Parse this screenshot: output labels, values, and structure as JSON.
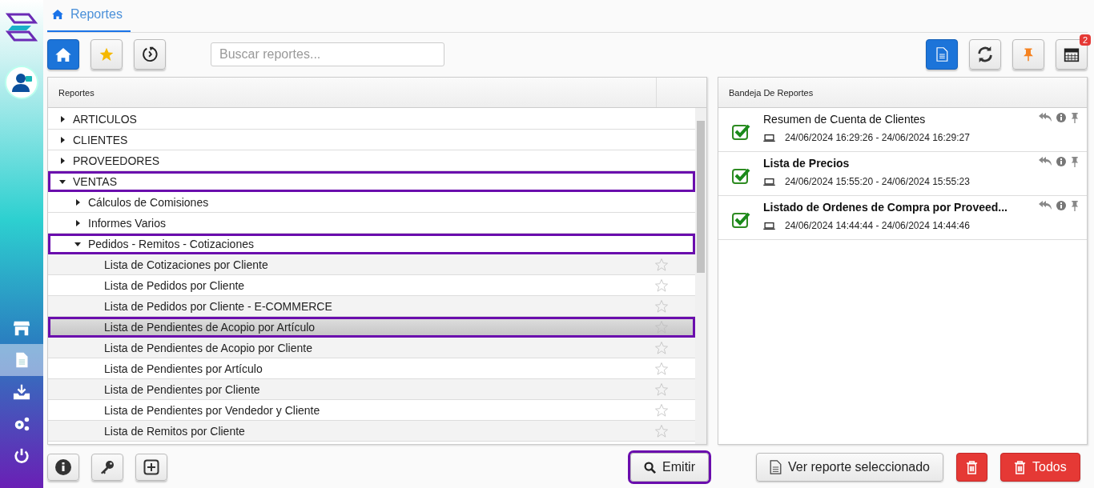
{
  "sidebar": {
    "items": [
      {
        "kind": "store",
        "selected": false
      },
      {
        "kind": "document",
        "selected": true
      },
      {
        "kind": "inbox",
        "selected": false
      },
      {
        "kind": "gears",
        "selected": false
      },
      {
        "kind": "power",
        "selected": false
      }
    ]
  },
  "tab": {
    "label": "Reportes",
    "selected": true
  },
  "search": {
    "placeholder": "Buscar reportes..."
  },
  "calendar_badge": "2",
  "reports_panel": {
    "title": "Reportes",
    "tree": [
      {
        "label": "ARTICULOS",
        "expanded": false,
        "highlighted": false
      },
      {
        "label": "CLIENTES",
        "expanded": false,
        "highlighted": false
      },
      {
        "label": "PROVEEDORES",
        "expanded": false,
        "highlighted": false
      },
      {
        "label": "VENTAS",
        "expanded": true,
        "highlighted": true,
        "children": [
          {
            "label": "Cálculos de Comisiones",
            "expanded": false,
            "highlighted": false
          },
          {
            "label": "Informes Varios",
            "expanded": false,
            "highlighted": false
          },
          {
            "label": "Pedidos - Remitos - Cotizaciones",
            "expanded": true,
            "highlighted": true,
            "children": [
              {
                "label": "Lista de Cotizaciones por Cliente",
                "starred": false,
                "selected": false,
                "highlighted": false
              },
              {
                "label": "Lista de Pedidos por Cliente",
                "starred": false,
                "selected": false,
                "highlighted": false
              },
              {
                "label": "Lista de Pedidos por Cliente - E-COMMERCE",
                "starred": false,
                "selected": false,
                "highlighted": false
              },
              {
                "label": "Lista de Pendientes de Acopio por Artículo",
                "starred": false,
                "selected": true,
                "highlighted": true
              },
              {
                "label": "Lista de Pendientes de Acopio por Cliente",
                "starred": false,
                "selected": false,
                "highlighted": false
              },
              {
                "label": "Lista de Pendientes por Artículo",
                "starred": false,
                "selected": false,
                "highlighted": false
              },
              {
                "label": "Lista de Pendientes por Cliente",
                "starred": false,
                "selected": false,
                "highlighted": false
              },
              {
                "label": "Lista de Pendientes por Vendedor y Cliente",
                "starred": false,
                "selected": false,
                "highlighted": false
              },
              {
                "label": "Lista de Remitos por Cliente",
                "starred": false,
                "selected": false,
                "highlighted": false
              }
            ]
          }
        ]
      }
    ]
  },
  "emit_button": {
    "label": "Emitir",
    "highlighted": true
  },
  "tray": {
    "title": "Bandeja De Reportes",
    "items": [
      {
        "title": "Resumen de Cuenta de Clientes",
        "unread": false,
        "done": true,
        "time": "24/06/2024 16:29:26 - 24/06/2024 16:29:27"
      },
      {
        "title": "Lista de Precios",
        "unread": true,
        "done": true,
        "time": "24/06/2024 15:55:20 - 24/06/2024 15:55:23"
      },
      {
        "title": "Listado de Ordenes de Compra por Proveed...",
        "unread": true,
        "done": true,
        "time": "24/06/2024 14:44:44 - 24/06/2024 14:44:46"
      }
    ]
  },
  "view_button": {
    "label": "Ver reporte seleccionado"
  },
  "delete_all_button": {
    "label": "Todos"
  }
}
